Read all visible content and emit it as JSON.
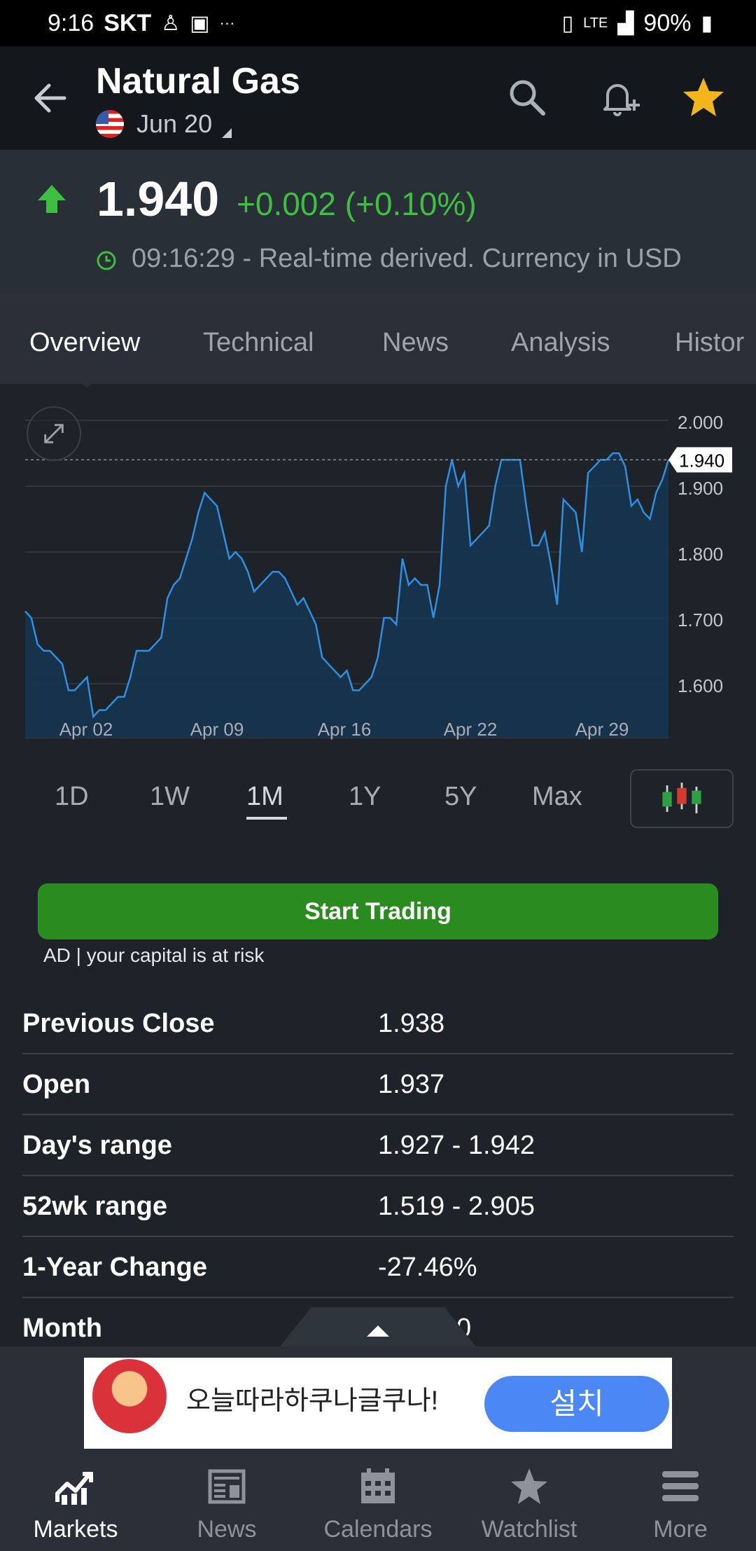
{
  "status_bar": {
    "time": "9:16",
    "carrier": "SKT",
    "dots": "···",
    "battery": "90%"
  },
  "header": {
    "title": "Natural Gas",
    "expiry": "Jun 20"
  },
  "quote": {
    "price": "1.940",
    "change": "+0.002 (+0.10%)",
    "timestamp": "09:16:29 - Real-time derived. Currency in USD",
    "change_color": "#3fbf3f"
  },
  "tabs": [
    "Overview",
    "Technical",
    "News",
    "Analysis",
    "Histor"
  ],
  "chart_data": {
    "type": "area",
    "x_labels": [
      "Apr 02",
      "Apr 09",
      "Apr 16",
      "Apr 22",
      "Apr 29"
    ],
    "y_ticks": [
      "2.000",
      "1.900",
      "1.800",
      "1.700",
      "1.600"
    ],
    "ylim": [
      1.55,
      2.0
    ],
    "current_label": "1.940",
    "values": [
      1.71,
      1.7,
      1.66,
      1.65,
      1.65,
      1.64,
      1.63,
      1.59,
      1.59,
      1.6,
      1.61,
      1.55,
      1.56,
      1.56,
      1.57,
      1.58,
      1.58,
      1.61,
      1.65,
      1.65,
      1.65,
      1.66,
      1.67,
      1.73,
      1.75,
      1.76,
      1.79,
      1.82,
      1.86,
      1.89,
      1.88,
      1.87,
      1.83,
      1.79,
      1.8,
      1.79,
      1.77,
      1.74,
      1.75,
      1.76,
      1.77,
      1.77,
      1.76,
      1.74,
      1.72,
      1.73,
      1.71,
      1.69,
      1.64,
      1.63,
      1.62,
      1.61,
      1.62,
      1.59,
      1.59,
      1.6,
      1.61,
      1.64,
      1.7,
      1.7,
      1.69,
      1.79,
      1.75,
      1.76,
      1.75,
      1.75,
      1.7,
      1.75,
      1.9,
      1.94,
      1.9,
      1.92,
      1.81,
      1.82,
      1.83,
      1.84,
      1.9,
      1.94,
      1.94,
      1.94,
      1.94,
      1.87,
      1.81,
      1.81,
      1.83,
      1.78,
      1.72,
      1.88,
      1.87,
      1.86,
      1.8,
      1.92,
      1.93,
      1.94,
      1.94,
      1.95,
      1.95,
      1.93,
      1.87,
      1.88,
      1.86,
      1.85,
      1.89,
      1.91,
      1.94
    ],
    "line_color": "#2f8fe0",
    "fill_color": "#163550"
  },
  "ranges": [
    "1D",
    "1W",
    "1M",
    "1Y",
    "5Y",
    "Max"
  ],
  "active_range": "1M",
  "trade": {
    "button": "Start Trading",
    "note": "AD | your capital is at risk"
  },
  "stats": [
    {
      "label": "Previous Close",
      "value": "1.938"
    },
    {
      "label": "Open",
      "value": "1.937"
    },
    {
      "label": "Day's range",
      "value": "1.927 - 1.942"
    },
    {
      "label": "52wk range",
      "value": "1.519 - 2.905"
    },
    {
      "label": "1-Year Change",
      "value": "-27.46%"
    },
    {
      "label": "Month",
      "value": "0"
    }
  ],
  "ad": {
    "text": "오늘따라하쿠나글쿠나!",
    "install": "설치"
  },
  "bottom_nav": [
    {
      "label": "Markets",
      "icon": "chart-line-icon"
    },
    {
      "label": "News",
      "icon": "news-icon"
    },
    {
      "label": "Calendars",
      "icon": "calendar-icon"
    },
    {
      "label": "Watchlist",
      "icon": "star-icon"
    },
    {
      "label": "More",
      "icon": "menu-icon"
    }
  ]
}
